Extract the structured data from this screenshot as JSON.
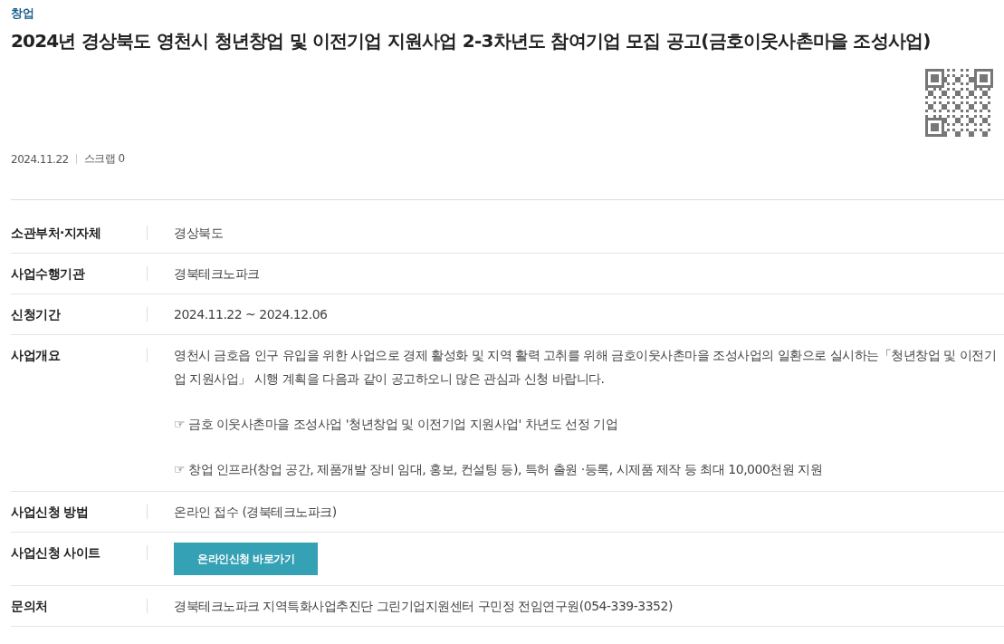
{
  "category": "창업",
  "title": "2024년 경상북도 영천시 청년창업 및 이전기업 지원사업 2-3차년도 참여기업 모집 공고(금호이웃사촌마을 조성사업)",
  "meta": {
    "date": "2024.11.22",
    "scrap": "스크랩 0"
  },
  "rows": [
    {
      "kind": "text",
      "label": "소관부처·지자체",
      "value": "경상북도"
    },
    {
      "kind": "text",
      "label": "사업수행기관",
      "value": "경북테크노파크"
    },
    {
      "kind": "text",
      "label": "신청기간",
      "value": "2024.11.22 ~ 2024.12.06"
    },
    {
      "kind": "paragraphs",
      "label": "사업개요",
      "paragraphs": [
        "영천시 금호읍 인구 유입을 위한 사업으로 경제 활성화 및 지역 활력 고취를 위해 금호이웃사촌마을 조성사업의 일환으로 실시하는「청년창업 및 이전기업 지원사업」 시행 계획을 다음과 같이 공고하오니 많은 관심과 신청 바랍니다.",
        "☞ 금호 이웃사촌마을 조성사업 '청년창업 및 이전기업 지원사업' 차년도 선정 기업",
        "☞ 창업 인프라(창업 공간, 제품개발 장비 임대, 홍보, 컨설팅 등), 특허 출원 ·등록, 시제품 제작 등 최대 10,000천원 지원"
      ]
    },
    {
      "kind": "text",
      "label": "사업신청 방법",
      "value": "온라인 접수 (경북테크노파크)"
    },
    {
      "kind": "button",
      "label": "사업신청 사이트",
      "value": "온라인신청 바로가기"
    },
    {
      "kind": "text",
      "label": "문의처",
      "value": "경북테크노파크 지역특화사업추진단 그린기업지원센터 구민정 전임연구원(054-339-3352)"
    }
  ]
}
